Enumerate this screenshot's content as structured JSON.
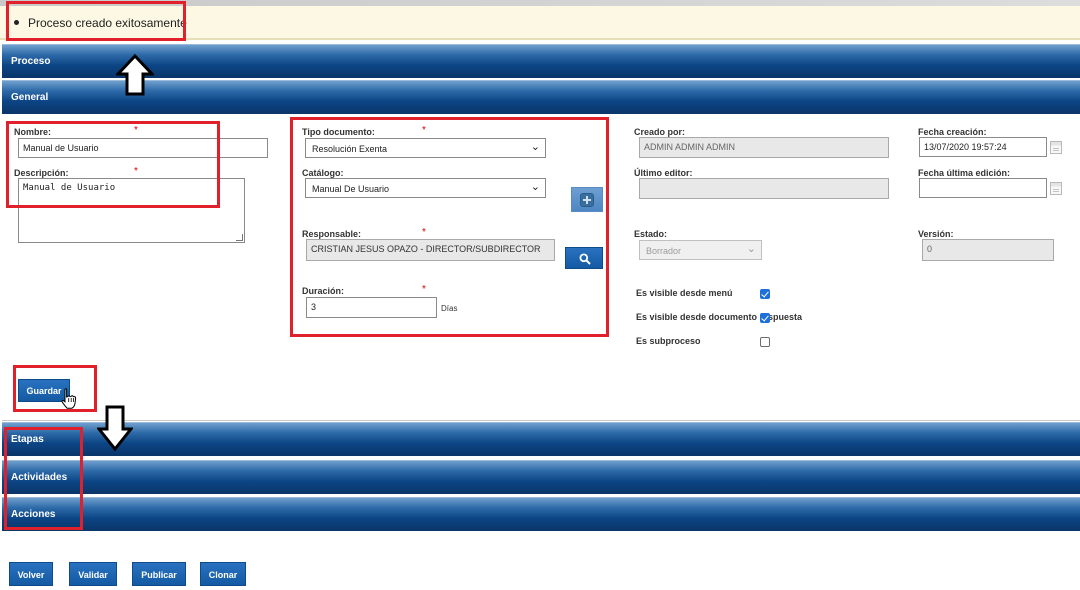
{
  "banner": {
    "message": "Proceso creado exitosamente"
  },
  "sections": {
    "proceso": "Proceso",
    "general": "General",
    "etapas": "Etapas",
    "actividades": "Actividades",
    "acciones": "Acciones"
  },
  "form": {
    "nombre": {
      "label": "Nombre:",
      "required": "*",
      "value": "Manual de Usuario"
    },
    "descripcion": {
      "label": "Descripción:",
      "required": "*",
      "value": "Manual de Usuario"
    },
    "tipo_documento": {
      "label": "Tipo documento:",
      "required": "*",
      "value": "Resolución Exenta"
    },
    "catalogo": {
      "label": "Catálogo:",
      "value": "Manual De Usuario"
    },
    "responsable": {
      "label": "Responsable:",
      "required": "*",
      "value": "CRISTIAN JESUS OPAZO - DIRECTOR/SUBDIRECTOR"
    },
    "duracion": {
      "label": "Duración:",
      "required": "*",
      "value": "3",
      "unit": "Días"
    },
    "creado_por": {
      "label": "Creado por:",
      "value": "ADMIN ADMIN ADMIN"
    },
    "fecha_creacion": {
      "label": "Fecha creación:",
      "value": "13/07/2020 19:57:24"
    },
    "ultimo_editor": {
      "label": "Último editor:",
      "value": ""
    },
    "fecha_ultima_edicion": {
      "label": "Fecha última edición:",
      "value": ""
    },
    "estado": {
      "label": "Estado:",
      "value": "Borrador"
    },
    "version": {
      "label": "Versión:",
      "value": "0"
    },
    "visible_menu": {
      "label": "Es visible desde menú",
      "checked": true
    },
    "visible_documento": {
      "label": "Es visible desde documento respuesta",
      "checked": true
    },
    "subproceso": {
      "label": "Es subproceso",
      "checked": false
    }
  },
  "buttons": {
    "guardar": "Guardar",
    "volver": "Volver",
    "validar": "Validar",
    "publicar": "Publicar",
    "clonar": "Clonar"
  },
  "icons": {
    "add": "plus-square-icon",
    "search": "search-icon",
    "calendar": "calendar-icon",
    "cursor": "hand-pointer-icon",
    "arrow_up": "up-arrow-icon",
    "arrow_down": "down-arrow-icon"
  },
  "colors": {
    "header_blue": "#0c4585",
    "button_blue": "#145aa3",
    "annotation_red": "#e0202a",
    "banner_bg": "#fcf8e3"
  }
}
